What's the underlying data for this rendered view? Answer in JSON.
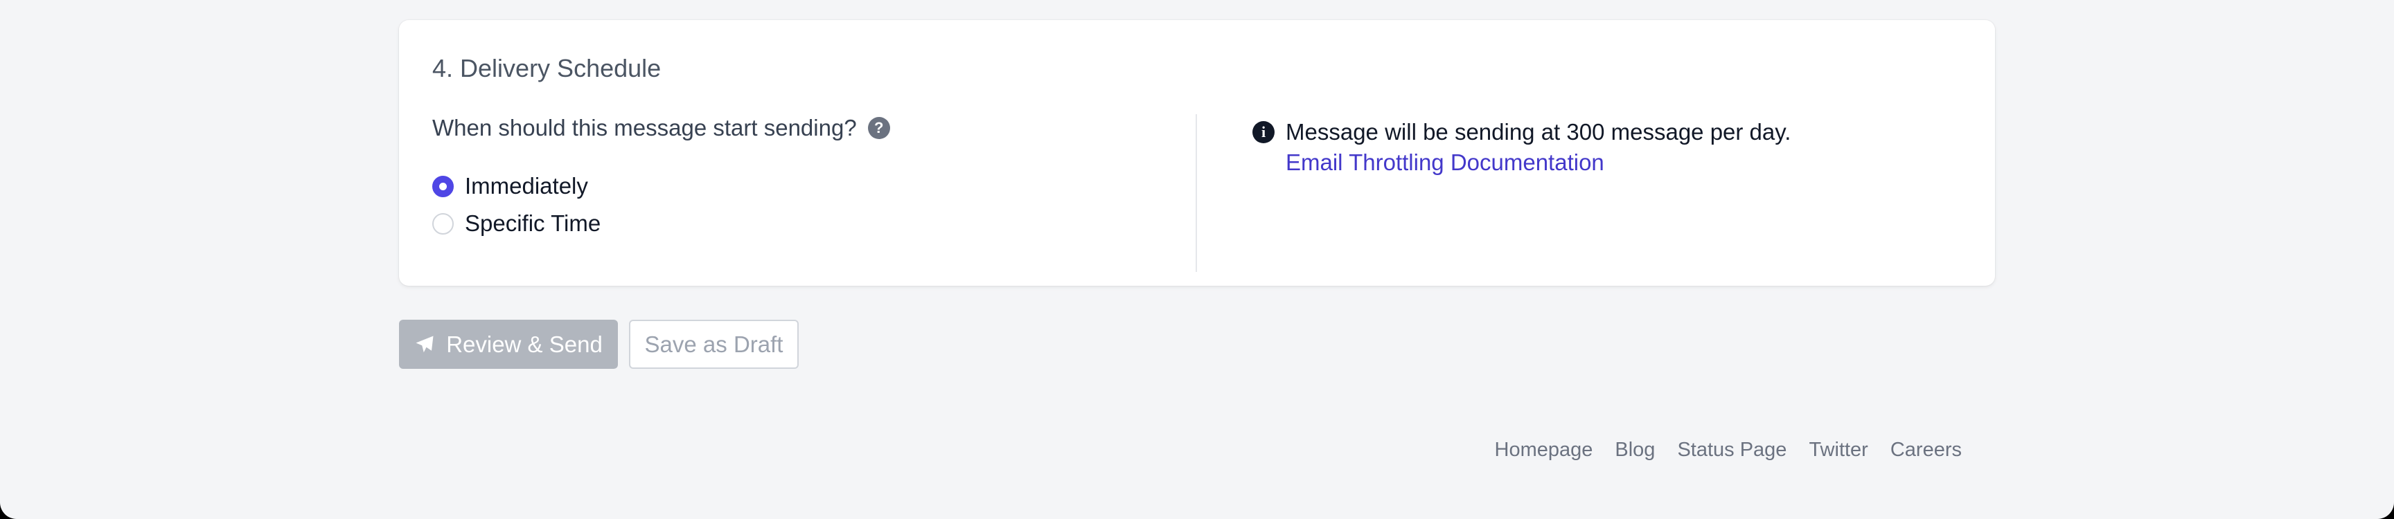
{
  "section": {
    "title": "4. Delivery Schedule",
    "question": "When should this message start sending?",
    "help_icon": "question-circle-icon",
    "options": [
      {
        "label": "Immediately",
        "selected": true
      },
      {
        "label": "Specific Time",
        "selected": false
      }
    ]
  },
  "info": {
    "icon": "info-circle-icon",
    "message": "Message will be sending at 300 message per day.",
    "link_label": "Email Throttling Documentation"
  },
  "actions": {
    "primary_icon": "paper-plane-icon",
    "primary_label": "Review & Send",
    "secondary_label": "Save as Draft"
  },
  "footer": {
    "links": [
      "Homepage",
      "Blog",
      "Status Page",
      "Twitter",
      "Careers"
    ]
  },
  "colors": {
    "accent": "#4f46e5",
    "link": "#4338ca",
    "background": "#f4f5f7",
    "disabled_button": "#b1b6be"
  }
}
